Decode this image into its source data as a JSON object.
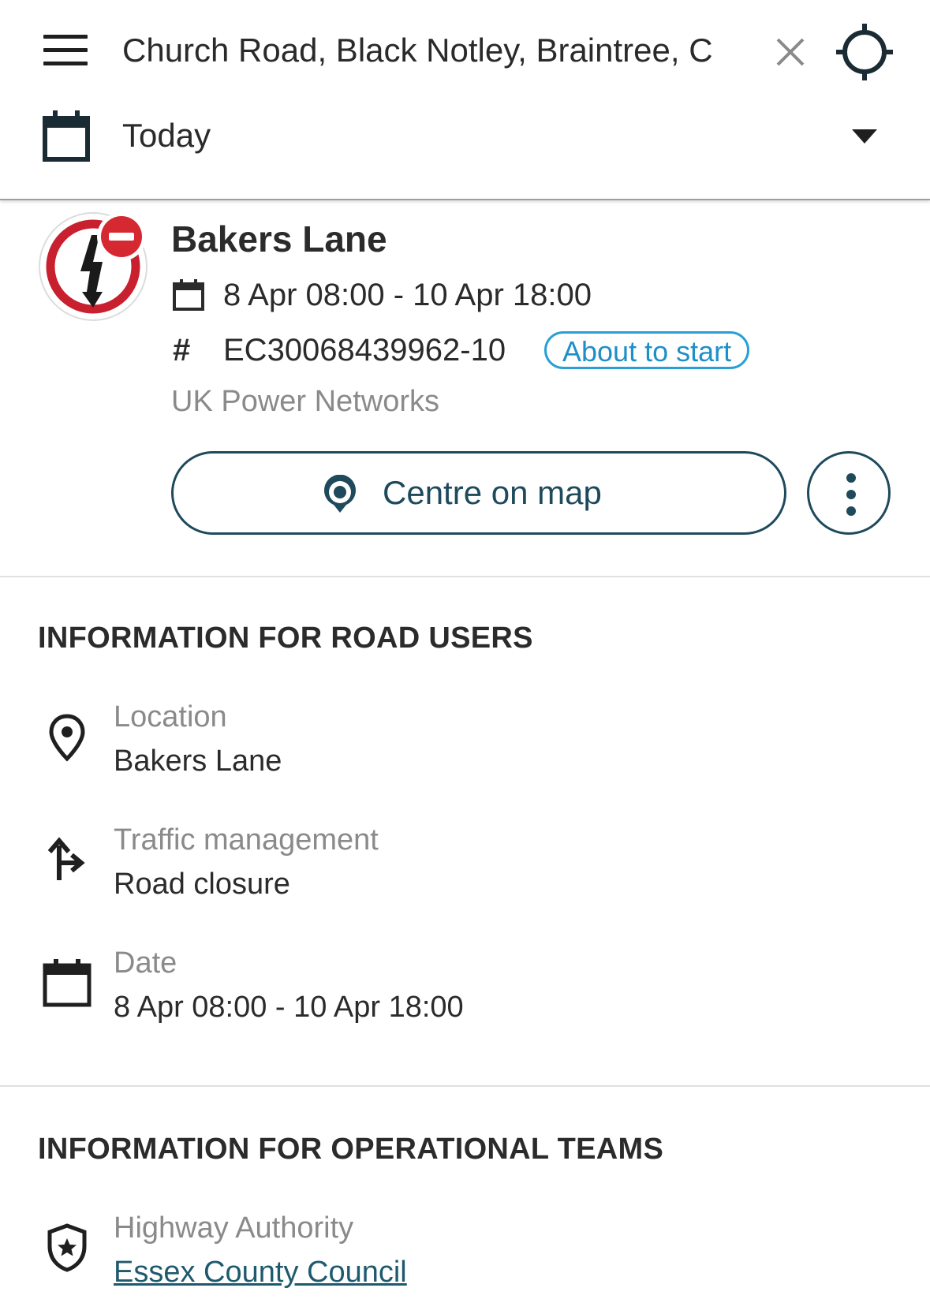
{
  "search": {
    "value": "Church Road, Black Notley, Braintree, C",
    "menu_icon": "hamburger-menu-icon",
    "clear_icon": "close-icon",
    "locate_icon": "crosshair-icon"
  },
  "date_filter": {
    "selected": "Today",
    "icon": "calendar-icon",
    "arrow_icon": "dropdown-arrow-icon"
  },
  "work": {
    "icon": "electric-works-road-closure-icon",
    "title": "Bakers Lane",
    "dates": "8 Apr 08:00 - 10 Apr 18:00",
    "reference": "EC30068439962-10",
    "status": "About to start",
    "organisation": "UK Power Networks",
    "centre_label": "Centre on map",
    "colors": {
      "accent": "#1e4a5c",
      "status": "#2a9fd6",
      "closure_red": "#c8202e"
    }
  },
  "road_users": {
    "heading": "INFORMATION FOR ROAD USERS",
    "location_label": "Location",
    "location_value": "Bakers Lane",
    "traffic_label": "Traffic management",
    "traffic_value": "Road closure",
    "date_label": "Date",
    "date_value": "8 Apr 08:00 - 10 Apr 18:00"
  },
  "operational": {
    "heading": "INFORMATION FOR OPERATIONAL TEAMS",
    "authority_label": "Highway Authority",
    "authority_value": "Essex County Council"
  }
}
